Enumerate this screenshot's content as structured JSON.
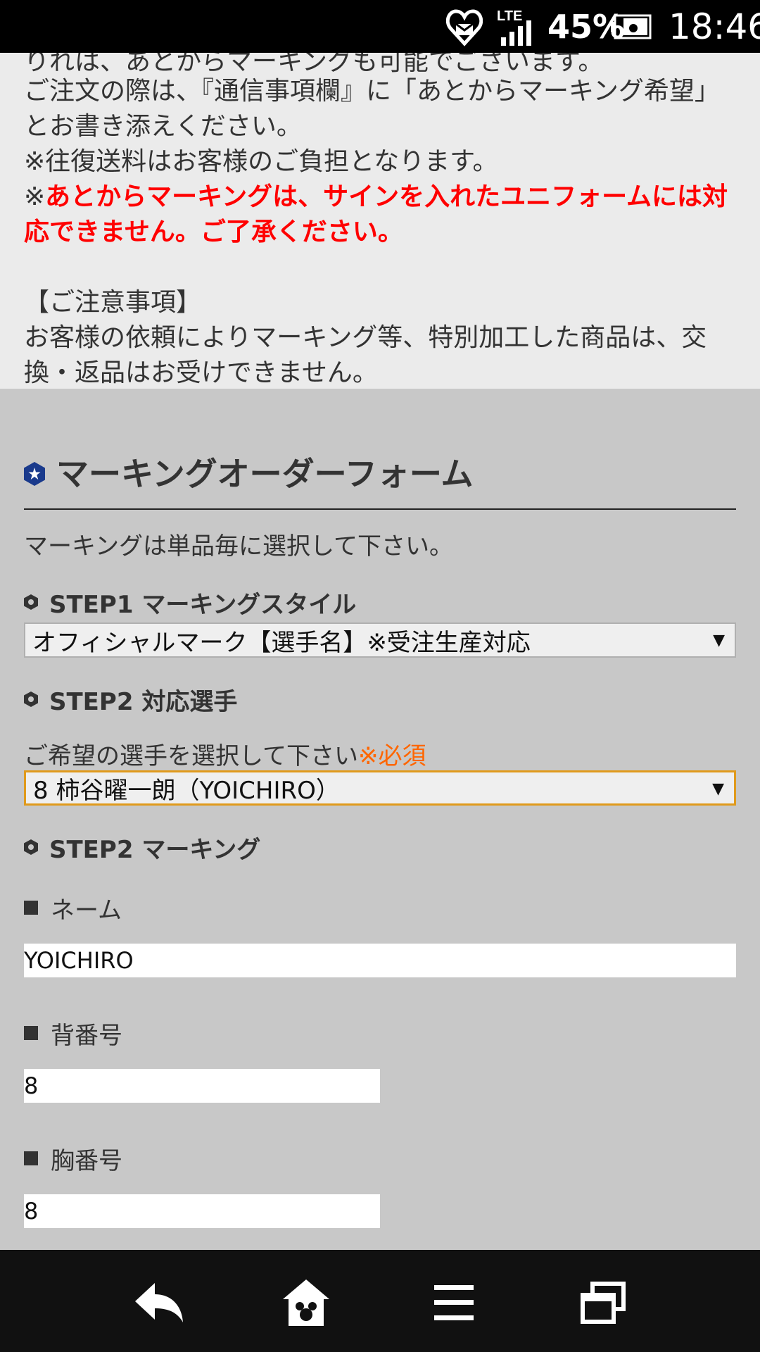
{
  "status_bar": {
    "heart_icon": "heart-mail-icon",
    "network": "LTE",
    "battery_percent": "45%",
    "time": "18:46"
  },
  "notice": {
    "line_cut": "りれは、あとからマーキングも可能でございます。",
    "line1": "ご注文の際は、『通信事項欄』に「あとからマーキング希望」",
    "line2": "とお書き添えください。",
    "line3": "※往復送料はお客様のご負担となります。",
    "line4_prefix": "※",
    "line4_red": "あとからマーキングは、サインを入れたユニフォームには対",
    "line5_red": "応できません。ご了承ください。",
    "caution_title": "【ご注意事項】",
    "caution_line1": "お客様の依頼によりマーキング等、特別加工した商品は、交",
    "caution_line2": "換・返品はお受けできません。"
  },
  "form": {
    "title": "マーキングオーダーフォーム",
    "instruction": "マーキングは単品毎に選択して下さい。",
    "step1": {
      "heading": "STEP1 マーキングスタイル",
      "selected": "オフィシャルマーク【選手名】※受注生産対応"
    },
    "step2_player": {
      "heading": "STEP2 対応選手",
      "prompt": "ご希望の選手を選択して下さい",
      "required": "※必須",
      "selected": "8 柿谷曜一朗（YOICHIRO）"
    },
    "step2_marking": {
      "heading": "STEP2 マーキング",
      "name_label": "ネーム",
      "name_value": "YOICHIRO",
      "back_number_label": "背番号",
      "back_number_value": "8",
      "chest_number_label": "胸番号",
      "chest_number_value": "8"
    }
  },
  "nav_bar": {
    "icons": [
      "back-icon",
      "home-mickey-icon",
      "menu-icon",
      "windows-icon"
    ]
  },
  "colors": {
    "red_notice": "#ff0000",
    "required": "#ff6600",
    "focus_border": "#e09a1c",
    "badge_blue": "#1a3a8c"
  }
}
